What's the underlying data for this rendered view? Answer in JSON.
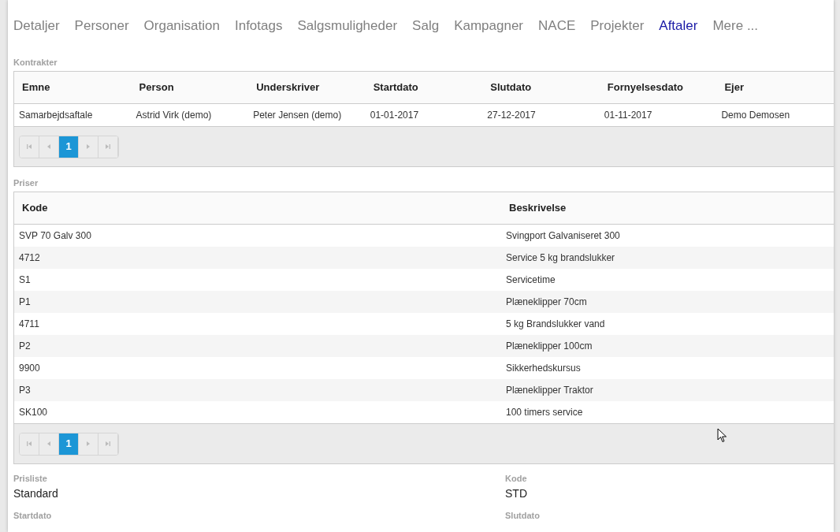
{
  "tabs": [
    {
      "label": "Detaljer",
      "selected": false
    },
    {
      "label": "Personer",
      "selected": false
    },
    {
      "label": "Organisation",
      "selected": false
    },
    {
      "label": "Infotags",
      "selected": false
    },
    {
      "label": "Salgsmuligheder",
      "selected": false
    },
    {
      "label": "Salg",
      "selected": false
    },
    {
      "label": "Kampagner",
      "selected": false
    },
    {
      "label": "NACE",
      "selected": false
    },
    {
      "label": "Projekter",
      "selected": false
    },
    {
      "label": "Aftaler",
      "selected": true
    },
    {
      "label": "Mere ...",
      "selected": false
    }
  ],
  "kontrakter": {
    "title": "Kontrakter",
    "columns": [
      "Emne",
      "Person",
      "Underskriver",
      "Startdato",
      "Slutdato",
      "Fornyelsesdato",
      "Ejer"
    ],
    "rows": [
      [
        "Samarbejdsaftale",
        "Astrid Virk (demo)",
        "Peter Jensen (demo)",
        "01-01-2017",
        "27-12-2017",
        "01-11-2017",
        "Demo Demosen"
      ]
    ],
    "pager": [
      {
        "label": "1",
        "selected": true
      }
    ]
  },
  "priser": {
    "title": "Priser",
    "columns": [
      "Kode",
      "Beskrivelse"
    ],
    "rows": [
      [
        "SVP 70 Galv 300",
        "Svingport Galvaniseret 300"
      ],
      [
        "4712",
        "Service 5 kg brandslukker"
      ],
      [
        "S1",
        "Servicetime"
      ],
      [
        "P1",
        "Plæneklipper 70cm"
      ],
      [
        "4711",
        "5 kg Brandslukker vand"
      ],
      [
        "P2",
        "Plæneklipper 100cm"
      ],
      [
        "9900",
        "Sikkerhedskursus"
      ],
      [
        "P3",
        "Plæneklipper Traktor"
      ],
      [
        "SK100",
        "100 timers service"
      ]
    ],
    "pager": [
      {
        "label": "1",
        "selected": true
      }
    ]
  },
  "fields": [
    {
      "label": "Prisliste",
      "value": "Standard"
    },
    {
      "label": "Kode",
      "value": "STD"
    },
    {
      "label": "Startdato"
    },
    {
      "label": "Slutdato"
    }
  ]
}
